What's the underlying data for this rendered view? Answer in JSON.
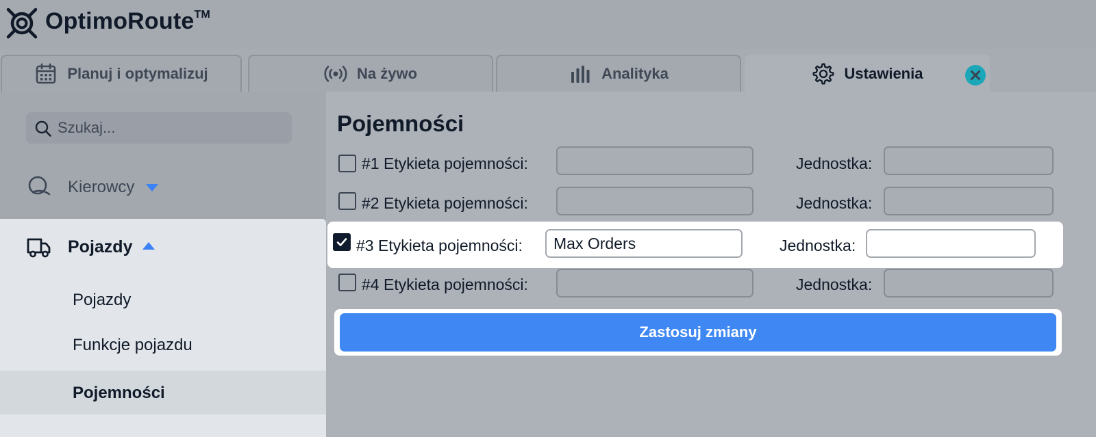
{
  "brand": {
    "name": "OptimoRoute",
    "trademark": "TM"
  },
  "tabs": [
    {
      "label": "Planuj i optymalizuj",
      "icon": "calendar-icon"
    },
    {
      "label": "Na żywo",
      "icon": "live-broadcast-icon"
    },
    {
      "label": "Analityka",
      "icon": "bar-chart-icon"
    },
    {
      "label": "Ustawienia",
      "icon": "gear-icon",
      "active": true
    }
  ],
  "sidebar": {
    "search": {
      "placeholder": "Szukaj..."
    },
    "drivers": {
      "label": "Kierowcy",
      "expanded": false
    },
    "vehicles": {
      "label": "Pojazdy",
      "expanded": true,
      "items": [
        {
          "label": "Pojazdy"
        },
        {
          "label": "Funkcje pojazdu"
        },
        {
          "label": "Pojemności",
          "selected": true
        }
      ]
    }
  },
  "main": {
    "title": "Pojemności",
    "rows": [
      {
        "label": "#1 Etykieta pojemności:",
        "checked": false,
        "value": "",
        "unit_label": "Jednostka:",
        "unit_value": ""
      },
      {
        "label": "#2 Etykieta pojemności:",
        "checked": false,
        "value": "",
        "unit_label": "Jednostka:",
        "unit_value": ""
      },
      {
        "label": "#3 Etykieta pojemności:",
        "checked": true,
        "value": "Max Orders",
        "unit_label": "Jednostka:",
        "unit_value": ""
      },
      {
        "label": "#4 Etykieta pojemności:",
        "checked": false,
        "value": "",
        "unit_label": "Jednostka:",
        "unit_value": ""
      }
    ],
    "apply_label": "Zastosuj zmiany"
  },
  "colors": {
    "accent": "#3f88f4",
    "close_badge": "#1ba7b8",
    "caret": "#3b82f6"
  }
}
